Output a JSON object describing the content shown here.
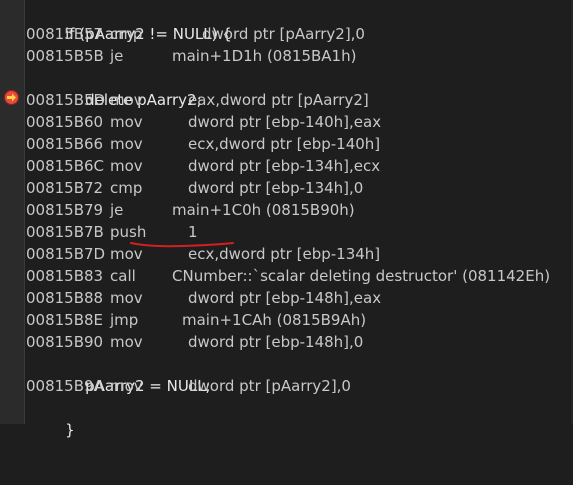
{
  "source_lines": {
    "l1": "if (pAarry2 != NULL) {",
    "l2": "delete pAarry2;",
    "l3": "pAarry2 = NULL;",
    "l4": "}"
  },
  "asm": [
    {
      "addr": "00815B57",
      "mn": "cmp",
      "ops": "dword ptr [pAarry2],0"
    },
    {
      "addr": "00815B5B",
      "mn": "je",
      "ops": "main+1D1h (0815BA1h)"
    },
    {
      "addr": "00815B5D",
      "mn": "mov",
      "ops": "eax,dword ptr [pAarry2]"
    },
    {
      "addr": "00815B60",
      "mn": "mov",
      "ops": "dword ptr [ebp-140h],eax"
    },
    {
      "addr": "00815B66",
      "mn": "mov",
      "ops": "ecx,dword ptr [ebp-140h]"
    },
    {
      "addr": "00815B6C",
      "mn": "mov",
      "ops": "dword ptr [ebp-134h],ecx"
    },
    {
      "addr": "00815B72",
      "mn": "cmp",
      "ops": "dword ptr [ebp-134h],0"
    },
    {
      "addr": "00815B79",
      "mn": "je",
      "ops": "main+1C0h (0815B90h)"
    },
    {
      "addr": "00815B7B",
      "mn": "push",
      "ops": "1"
    },
    {
      "addr": "00815B7D",
      "mn": "mov",
      "ops": "ecx,dword ptr [ebp-134h]"
    },
    {
      "addr": "00815B83",
      "mn": "call",
      "ops": "CNumber::`scalar deleting destructor' (081142Eh)"
    },
    {
      "addr": "00815B88",
      "mn": "mov",
      "ops": "dword ptr [ebp-148h],eax"
    },
    {
      "addr": "00815B8E",
      "mn": "jmp",
      "ops": "main+1CAh (0815B9Ah)"
    },
    {
      "addr": "00815B90",
      "mn": "mov",
      "ops": "dword ptr [ebp-148h],0"
    },
    {
      "addr": "00815B9A",
      "mn": "mov",
      "ops": "dword ptr [pAarry2],0"
    }
  ],
  "colors": {
    "background": "#1e1e1e",
    "text": "#d4d4d4",
    "current_instruction_marker": "#e84b3c",
    "annotation_underline": "#d21f1f"
  },
  "icons": {
    "current_instruction": "instruction-pointer-arrow-icon"
  }
}
